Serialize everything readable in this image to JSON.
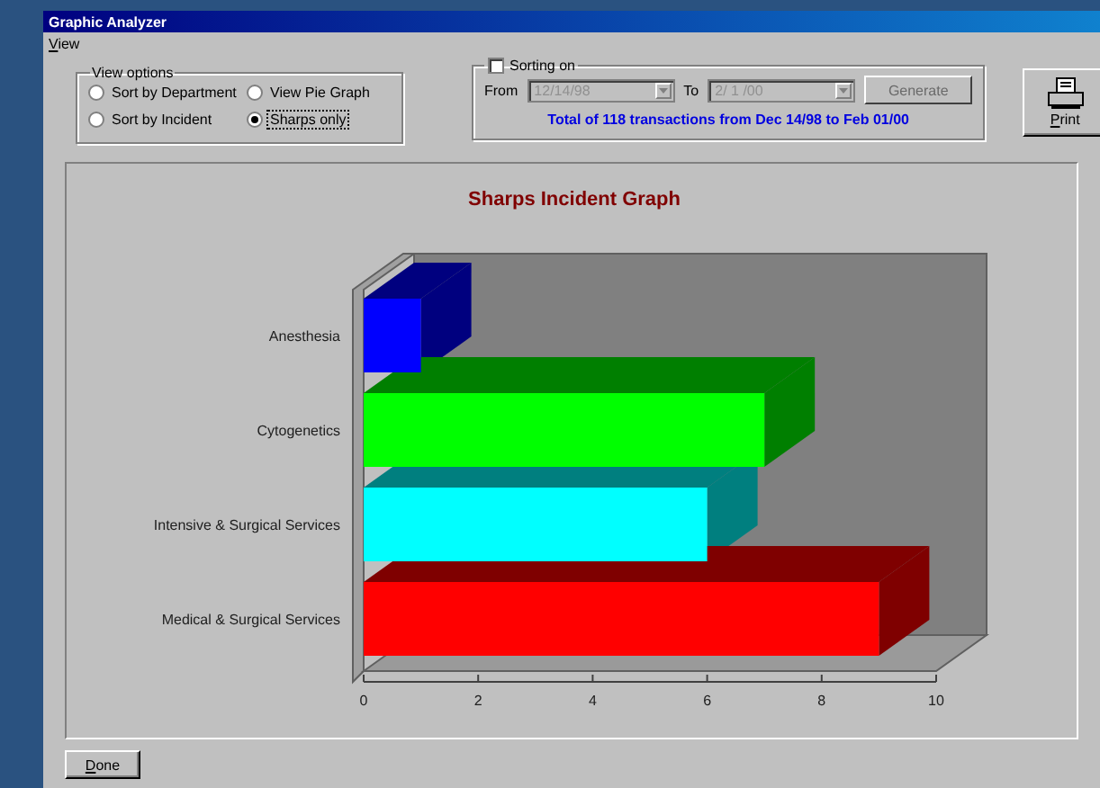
{
  "window": {
    "title": "Graphic Analyzer"
  },
  "menu": [
    {
      "label": "View"
    }
  ],
  "view_options": {
    "title": "View options",
    "options": [
      {
        "label": "Sort by Department",
        "selected": false
      },
      {
        "label": "View Pie Graph",
        "selected": false
      },
      {
        "label": "Sort by Incident",
        "selected": false
      },
      {
        "label": "Sharps only",
        "selected": true
      }
    ]
  },
  "sorting": {
    "label": "Sorting on",
    "checked": false,
    "disabled": true,
    "from_label": "From",
    "from_value": "12/14/98",
    "to_label": "To",
    "to_value": "2/ 1 /00",
    "generate": "Generate",
    "summary": "Total of 118 transactions from Dec 14/98 to Feb 01/00"
  },
  "print_button": {
    "label": "Print"
  },
  "chart": {
    "bars": [
      {
        "color": "#0000ff"
      },
      {
        "color": "#00ff00"
      },
      {
        "color": "#00ffff"
      },
      {
        "color": "#ff0000"
      }
    ],
    "chart_data": {
      "type": "bar",
      "orientation": "horizontal",
      "title": "Sharps Incident Graph",
      "categories": [
        "Anesthesia",
        "Cytogenetics",
        "Intensive & Surgical Services",
        "Medical & Surgical Services"
      ],
      "values": [
        1,
        7,
        6,
        9
      ],
      "xlim": [
        0,
        10
      ],
      "xticks": [
        0,
        2,
        4,
        6,
        8,
        10
      ]
    }
  },
  "done_button": {
    "label": "Done"
  }
}
